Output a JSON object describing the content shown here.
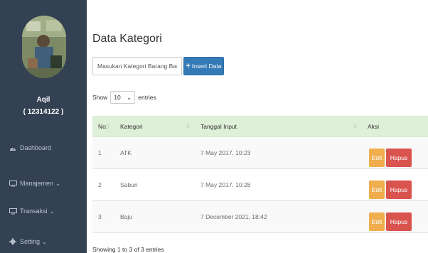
{
  "sidebar": {
    "user_name": "Aqil",
    "user_id": "( 12314122 )",
    "items": [
      {
        "label": "Dashboard",
        "icon": "tachometer-icon",
        "has_dropdown": false
      },
      {
        "label": "Manajemen",
        "icon": "monitor-icon",
        "has_dropdown": true
      },
      {
        "label": "Transaksi",
        "icon": "monitor-icon",
        "has_dropdown": true
      },
      {
        "label": "Setting",
        "icon": "gear-icon",
        "has_dropdown": true
      }
    ],
    "chevron": "⌄"
  },
  "main": {
    "title": "Data Kategori",
    "input_placeholder": "Masukan Kategori Barang Baru",
    "insert_label": "Insert Data",
    "show_label": "Show",
    "entries_value": "10",
    "entries_label": "entries",
    "table": {
      "headers": [
        "No.",
        "Kategori",
        "Tanggal Input",
        "Aksi"
      ],
      "rows": [
        {
          "no": "1",
          "kategori": "ATK",
          "tanggal": "7 May 2017, 10:23"
        },
        {
          "no": "2",
          "kategori": "Sabun",
          "tanggal": "7 May 2017, 10:28"
        },
        {
          "no": "3",
          "kategori": "Baju",
          "tanggal": "7 December 2021, 18:42"
        }
      ],
      "edit_label": "Edit",
      "hapus_label": "Hapus"
    },
    "showing_text": "Showing 1 to 3 of 3 entries"
  },
  "colors": {
    "sidebar_bg": "#334153",
    "primary": "#337ab7",
    "warning": "#f0ad4e",
    "danger": "#d9534f",
    "header_success": "#dff0d8"
  }
}
